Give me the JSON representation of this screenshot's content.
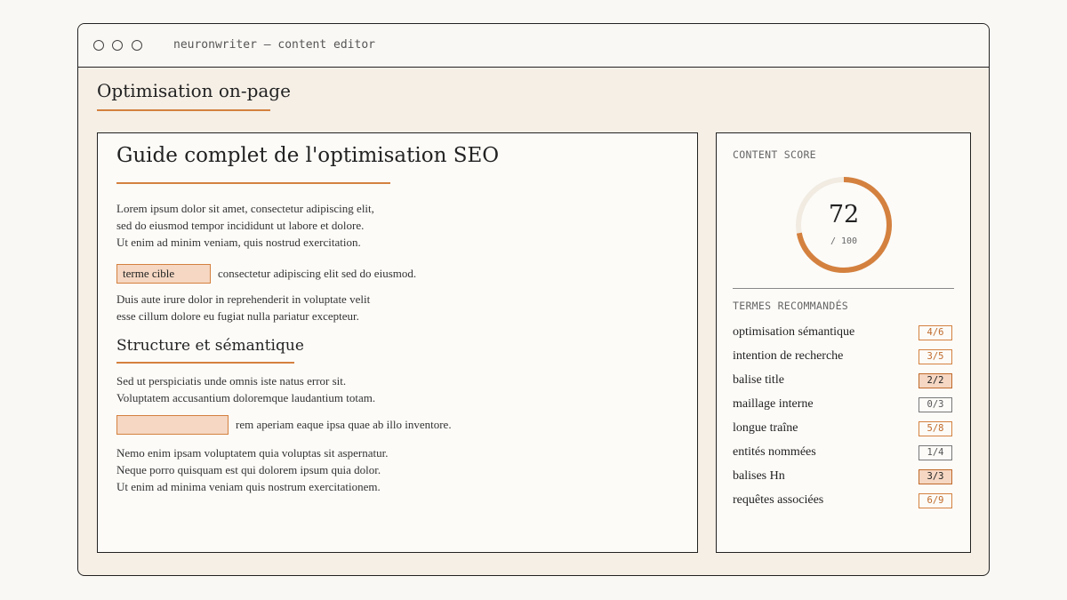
{
  "app": {
    "title": "neuronwriter — content editor"
  },
  "page": {
    "title": "Optimisation on-page"
  },
  "editor": {
    "heading": "Guide complet de l'optimisation SEO",
    "para1": [
      "Lorem ipsum dolor sit amet, consectetur adipiscing elit,",
      "sed do eiusmod tempor incididunt ut labore et dolore.",
      "Ut enim ad minim veniam, quis nostrud exercitation."
    ],
    "highlight1": {
      "term": "terme cible",
      "after": "consectetur adipiscing elit sed do eiusmod."
    },
    "para2": [
      "Duis aute irure dolor in reprehenderit in voluptate velit",
      "esse cillum dolore eu fugiat nulla pariatur excepteur."
    ],
    "subheading": "Structure et sémantique",
    "para3": [
      "Sed ut perspiciatis unde omnis iste natus error sit.",
      "Voluptatem accusantium doloremque laudantium totam."
    ],
    "highlight2": {
      "term": "",
      "after": "rem aperiam eaque ipsa quae ab illo inventore."
    },
    "para4": [
      "Nemo enim ipsam voluptatem quia voluptas sit aspernatur.",
      "Neque porro quisquam est qui dolorem ipsum quia dolor.",
      "Ut enim ad minima veniam quis nostrum exercitationem."
    ]
  },
  "score": {
    "label": "CONTENT SCORE",
    "value": "72",
    "max_label": "/ 100",
    "fraction": 0.72,
    "accent": "#d4813f",
    "track": "#f1ebe2"
  },
  "terms": {
    "label": "TERMES RECOMMANDÉS",
    "items": [
      {
        "name": "optimisation sémantique",
        "count": "4/6",
        "status": "partial"
      },
      {
        "name": "intention de recherche",
        "count": "3/5",
        "status": "partial"
      },
      {
        "name": "balise title",
        "count": "2/2",
        "status": "done"
      },
      {
        "name": "maillage interne",
        "count": "0/3",
        "status": "low"
      },
      {
        "name": "longue traîne",
        "count": "5/8",
        "status": "partial"
      },
      {
        "name": "entités nommées",
        "count": "1/4",
        "status": "low"
      },
      {
        "name": "balises Hn",
        "count": "3/3",
        "status": "done"
      },
      {
        "name": "requêtes associées",
        "count": "6/9",
        "status": "partial"
      }
    ]
  }
}
